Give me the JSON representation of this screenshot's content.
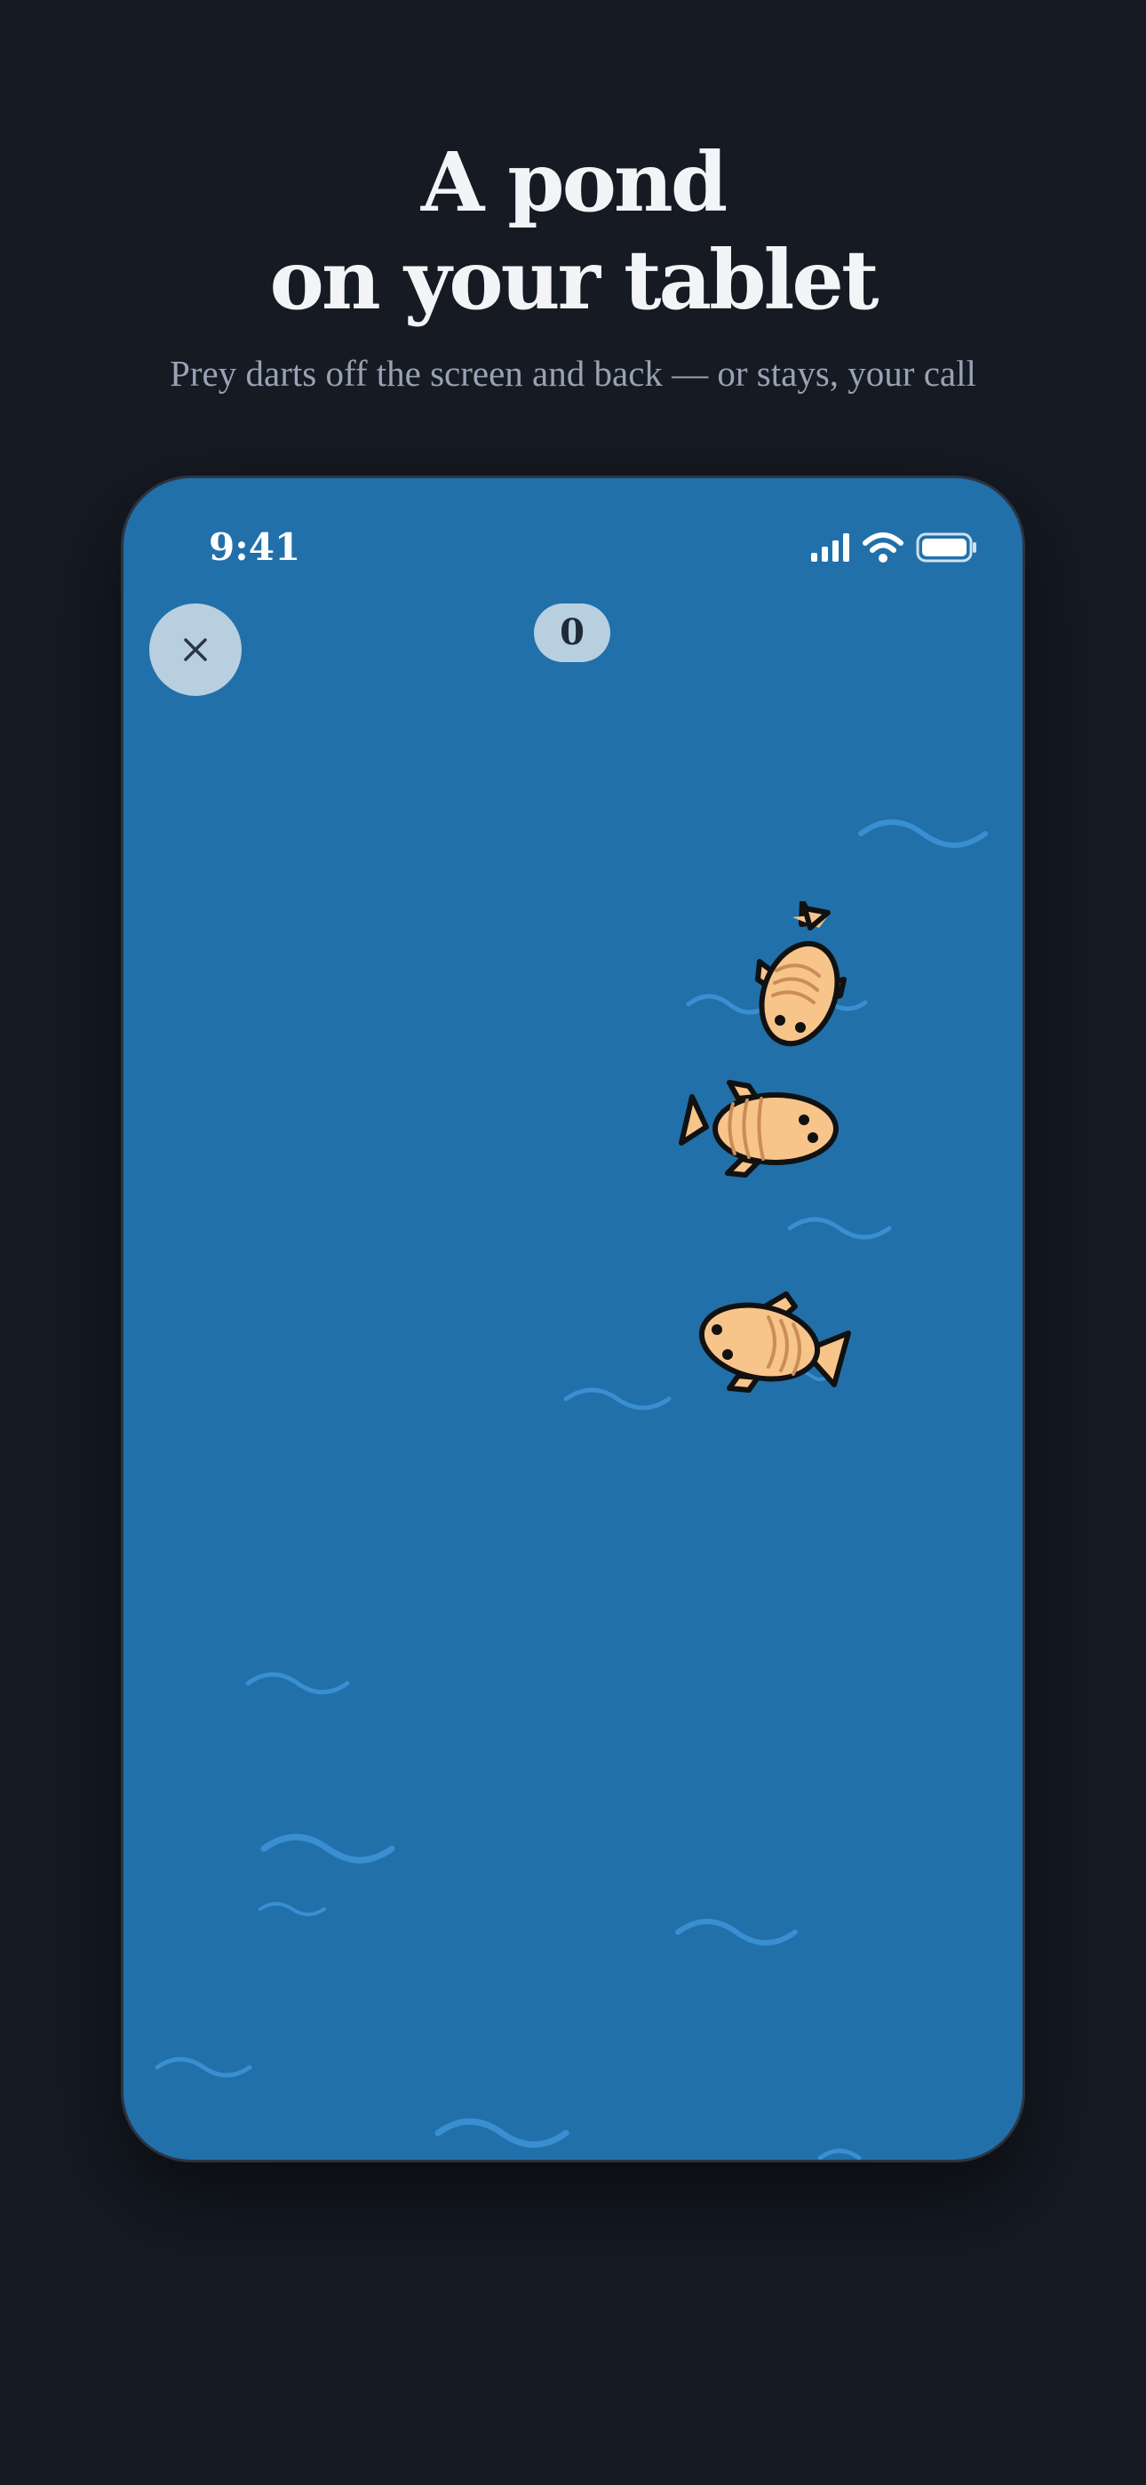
{
  "headline": {
    "line1": "A pond",
    "line2": "on your tablet"
  },
  "subhead": "Prey darts off the screen and back — or stays, your call",
  "status_bar": {
    "time": "9:41",
    "icons": [
      "cellular-signal-icon",
      "wifi-icon",
      "battery-icon"
    ]
  },
  "game": {
    "close_icon": "close-icon",
    "score": "0",
    "prey": [
      "fish",
      "fish",
      "fish"
    ]
  },
  "colors": {
    "page_background": "#151a23",
    "pond_water": "#2170aa",
    "ripple": "#3a8ed2",
    "fish_body": "#f7c48a",
    "fish_outline": "#111111",
    "control_fill": "#b8cfe0"
  }
}
